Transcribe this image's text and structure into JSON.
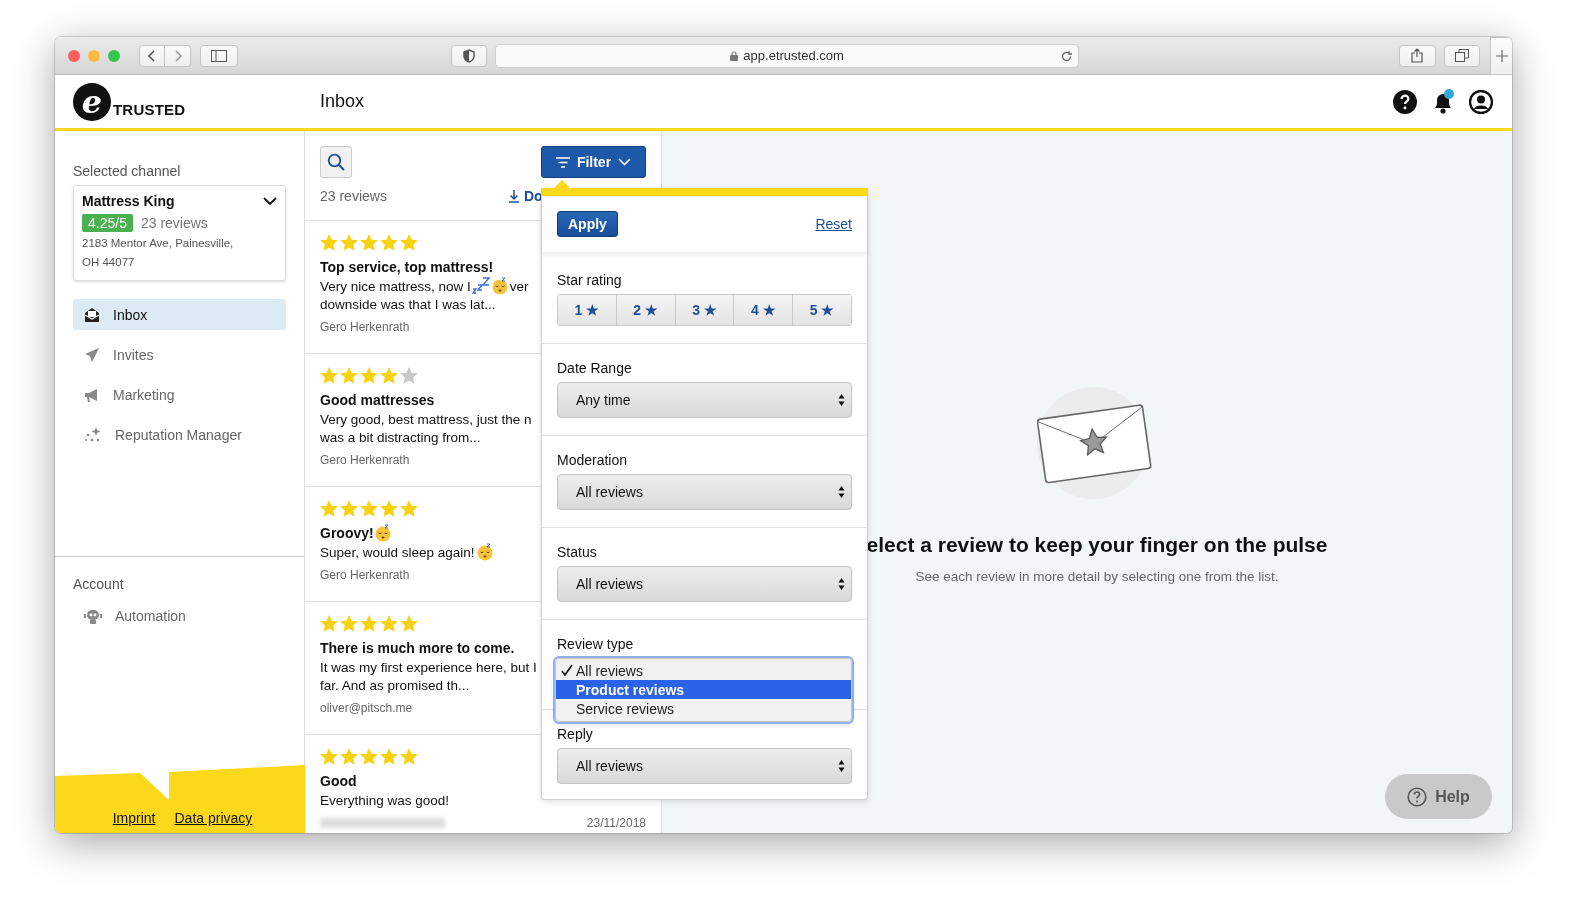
{
  "browser": {
    "url": "app.etrusted.com"
  },
  "header": {
    "logo_mark": "e",
    "logo_text": "TRUSTED",
    "page_title": "Inbox",
    "notification_dot": true
  },
  "sidebar": {
    "channel_label": "Selected channel",
    "channel": {
      "name": "Mattress King",
      "rating": "4.25/5",
      "review_count": "23 reviews",
      "address": "2183 Mentor Ave, Painesville, OH 44077"
    },
    "nav": [
      {
        "label": "Inbox",
        "kind": "inbox",
        "selected": true
      },
      {
        "label": "Invites",
        "kind": "plane",
        "selected": false
      },
      {
        "label": "Marketing",
        "kind": "megaphone",
        "selected": false
      },
      {
        "label": "Reputation Manager",
        "kind": "sparkle",
        "selected": false
      }
    ],
    "account_label": "Account",
    "account_nav": [
      {
        "label": "Automation",
        "kind": "robot",
        "selected": false
      }
    ],
    "footer_links": [
      "Imprint",
      "Data privacy"
    ]
  },
  "list": {
    "count": "23 reviews",
    "download": "Do",
    "filter": "Filter",
    "reviews": [
      {
        "stars": 5,
        "title": [
          {
            "kind": "text",
            "text": "Top service, top mattress!"
          }
        ],
        "lines": [
          [
            {
              "kind": "text",
              "text": "Very nice mattress, now I"
            },
            {
              "kind": "zzz"
            },
            {
              "kind": "sleepy"
            },
            {
              "kind": "text",
              "text": "ver"
            }
          ],
          [
            {
              "kind": "text",
              "text": "downside was that I was lat..."
            }
          ]
        ],
        "author": "Gero Herkenrath"
      },
      {
        "stars": 4,
        "title": [
          {
            "kind": "text",
            "text": "Good mattresses"
          }
        ],
        "lines": [
          [
            {
              "kind": "text",
              "text": "Very good, best mattress, just the n"
            }
          ],
          [
            {
              "kind": "text",
              "text": "was a bit distracting from..."
            }
          ]
        ],
        "author": "Gero Herkenrath"
      },
      {
        "stars": 5,
        "title": [
          {
            "kind": "text",
            "text": "Groovy!"
          },
          {
            "kind": "sleepy"
          }
        ],
        "lines": [
          [
            {
              "kind": "text",
              "text": "Super, would sleep again!"
            },
            {
              "kind": "sleepy"
            }
          ]
        ],
        "author": "Gero Herkenrath"
      },
      {
        "stars": 5,
        "title": [
          {
            "kind": "text",
            "text": "There is much more to come."
          }
        ],
        "lines": [
          [
            {
              "kind": "text",
              "text": "It was my first experience here, but I"
            }
          ],
          [
            {
              "kind": "text",
              "text": "far. And as promised th..."
            }
          ]
        ],
        "author": "oliver@pitsch.me"
      },
      {
        "stars": 5,
        "title": [
          {
            "kind": "text",
            "text": "Good"
          }
        ],
        "lines": [
          [
            {
              "kind": "text",
              "text": "Everything was good!"
            }
          ]
        ],
        "author_blurred": true,
        "date": "23/11/2018"
      }
    ]
  },
  "filter_panel": {
    "apply": "Apply",
    "reset": "Reset",
    "sections": [
      {
        "kind": "stars",
        "label": "Star rating",
        "options": [
          {
            "label": "1 ★",
            "selected": false
          },
          {
            "label": "2 ★",
            "selected": false
          },
          {
            "label": "3 ★",
            "selected": false
          },
          {
            "label": "4 ★",
            "selected": false
          },
          {
            "label": "5 ★",
            "selected": false
          }
        ]
      },
      {
        "kind": "select",
        "label": "Date Range",
        "value": "Any time"
      },
      {
        "kind": "select",
        "label": "Moderation",
        "value": "All reviews"
      },
      {
        "kind": "select",
        "label": "Status",
        "value": "All reviews"
      },
      {
        "kind": "open-select",
        "label": "Review type",
        "options": [
          {
            "label": "All reviews",
            "checked": true,
            "selected": false
          },
          {
            "label": "Product reviews",
            "checked": false,
            "selected": true
          },
          {
            "label": "Service reviews",
            "checked": false,
            "selected": false
          }
        ]
      },
      {
        "kind": "select",
        "label": "Reply",
        "value": "All reviews"
      }
    ]
  },
  "detail": {
    "title": "elect a review to keep your finger on the pulse",
    "subtitle": "See each review in more detail by selecting one from the list.",
    "help": "Help"
  }
}
